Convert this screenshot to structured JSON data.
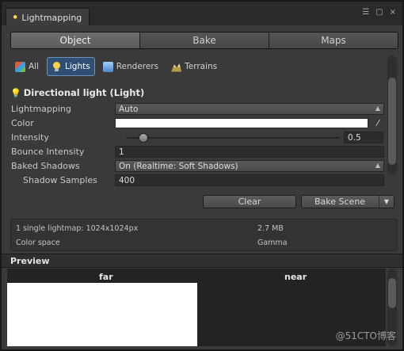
{
  "window": {
    "tab_title": "Lightmapping",
    "title_buttons": [
      "☰",
      "▢",
      "×"
    ]
  },
  "mode_tabs": [
    {
      "label": "Object",
      "active": true
    },
    {
      "label": "Bake",
      "active": false
    },
    {
      "label": "Maps",
      "active": false
    }
  ],
  "filters": [
    {
      "label": "All",
      "icon": "all-objects-icon",
      "active": false
    },
    {
      "label": "Lights",
      "icon": "bulb-icon",
      "active": true
    },
    {
      "label": "Renderers",
      "icon": "renderer-icon",
      "active": false
    },
    {
      "label": "Terrains",
      "icon": "terrain-icon",
      "active": false
    }
  ],
  "section": {
    "title": "Directional light (Light)"
  },
  "properties": {
    "lightmapping": {
      "label": "Lightmapping",
      "value": "Auto"
    },
    "color": {
      "label": "Color",
      "value": "#ffffff"
    },
    "intensity": {
      "label": "Intensity",
      "value": "0.5",
      "slider_fraction": 0.06
    },
    "bounce_intensity": {
      "label": "Bounce Intensity",
      "value": "1"
    },
    "baked_shadows": {
      "label": "Baked Shadows",
      "value": "On (Realtime: Soft Shadows)"
    },
    "shadow_samples": {
      "label": "Shadow Samples",
      "value": "400"
    }
  },
  "actions": {
    "clear": "Clear",
    "bake_scene": "Bake Scene"
  },
  "info": {
    "lightmap_desc": "1 single lightmap: 1024x1024px",
    "size": "2.7 MB",
    "color_space_label": "Color space",
    "color_space_value": "Gamma"
  },
  "preview": {
    "title": "Preview",
    "far_label": "far",
    "near_label": "near"
  },
  "watermark": "@51CTO博客",
  "colors": {
    "background": "#3a3a3a",
    "active_filter": "#2f4f74",
    "accent_icon": "#ffd24a"
  }
}
